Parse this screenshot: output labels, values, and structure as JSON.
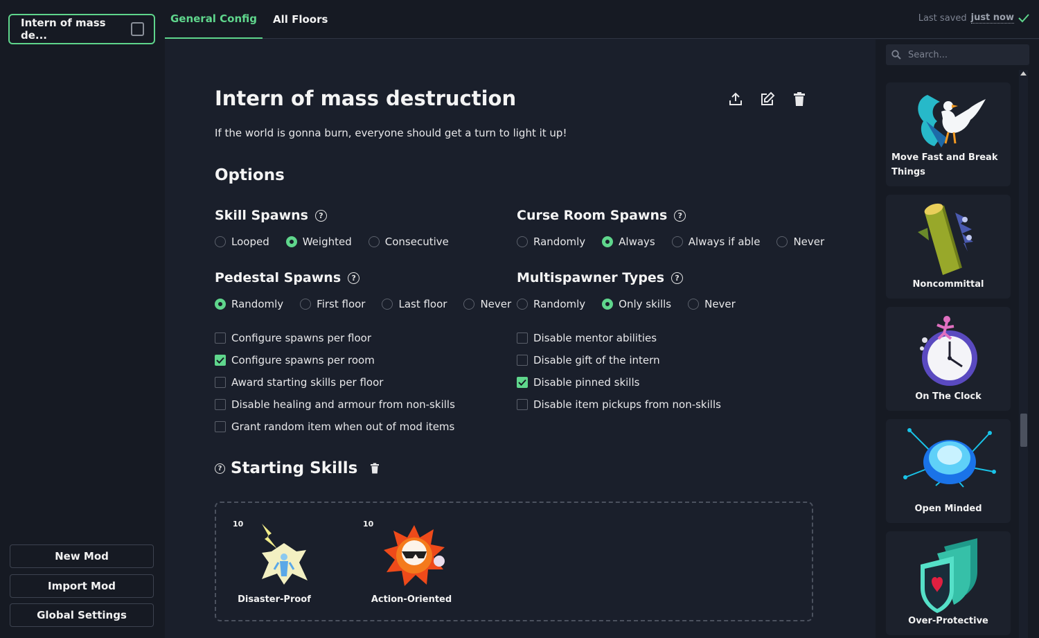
{
  "sidebar": {
    "mod_chip_label": "Intern of mass de...",
    "new_mod": "New Mod",
    "import_mod": "Import Mod",
    "global_settings": "Global Settings"
  },
  "tabs": [
    {
      "label": "General Config",
      "active": true
    },
    {
      "label": "All Floors",
      "active": false
    }
  ],
  "save_status": {
    "prefix": "Last saved",
    "time": "just now"
  },
  "mod": {
    "title": "Intern of mass destruction",
    "description": "If the world is gonna burn, everyone should get a turn to light it up!"
  },
  "options_heading": "Options",
  "groups": {
    "skill_spawns": {
      "title": "Skill Spawns",
      "options": [
        "Looped",
        "Weighted",
        "Consecutive"
      ],
      "selected": "Weighted"
    },
    "curse_room_spawns": {
      "title": "Curse Room Spawns",
      "options": [
        "Randomly",
        "Always",
        "Always if able",
        "Never"
      ],
      "selected": "Always"
    },
    "pedestal_spawns": {
      "title": "Pedestal Spawns",
      "options": [
        "Randomly",
        "First floor",
        "Last floor",
        "Never"
      ],
      "selected": "Randomly"
    },
    "multispawner_types": {
      "title": "Multispawner Types",
      "options": [
        "Randomly",
        "Only skills",
        "Never"
      ],
      "selected": "Only skills"
    }
  },
  "checkboxes_left": [
    {
      "label": "Configure spawns per floor",
      "checked": false
    },
    {
      "label": "Configure spawns per room",
      "checked": true
    },
    {
      "label": "Award starting skills per floor",
      "checked": false
    },
    {
      "label": "Disable healing and armour from non-skills",
      "checked": false
    },
    {
      "label": "Grant random item when out of mod items",
      "checked": false
    }
  ],
  "checkboxes_right": [
    {
      "label": "Disable mentor abilities",
      "checked": false
    },
    {
      "label": "Disable gift of the intern",
      "checked": false
    },
    {
      "label": "Disable pinned skills",
      "checked": true
    },
    {
      "label": "Disable item pickups from non-skills",
      "checked": false
    }
  ],
  "starting_skills": {
    "heading": "Starting Skills",
    "items": [
      {
        "name": "Disaster-Proof",
        "count": "10",
        "icon": "lightning-figure-icon"
      },
      {
        "name": "Action-Oriented",
        "count": "10",
        "icon": "explosion-sunglasses-icon"
      }
    ]
  },
  "skill_panel": {
    "search_placeholder": "Search...",
    "cards": [
      {
        "name": "Move Fast and Break Things",
        "icon": "goose-icon"
      },
      {
        "name": "Noncommittal",
        "icon": "log-icon"
      },
      {
        "name": "On The Clock",
        "icon": "clock-icon"
      },
      {
        "name": "Open Minded",
        "icon": "brain-icon"
      },
      {
        "name": "Over-Protective",
        "icon": "shield-icon"
      }
    ]
  },
  "colors": {
    "accent": "#5fd68c",
    "background": "#1a1f2b",
    "panel": "#161a23"
  }
}
